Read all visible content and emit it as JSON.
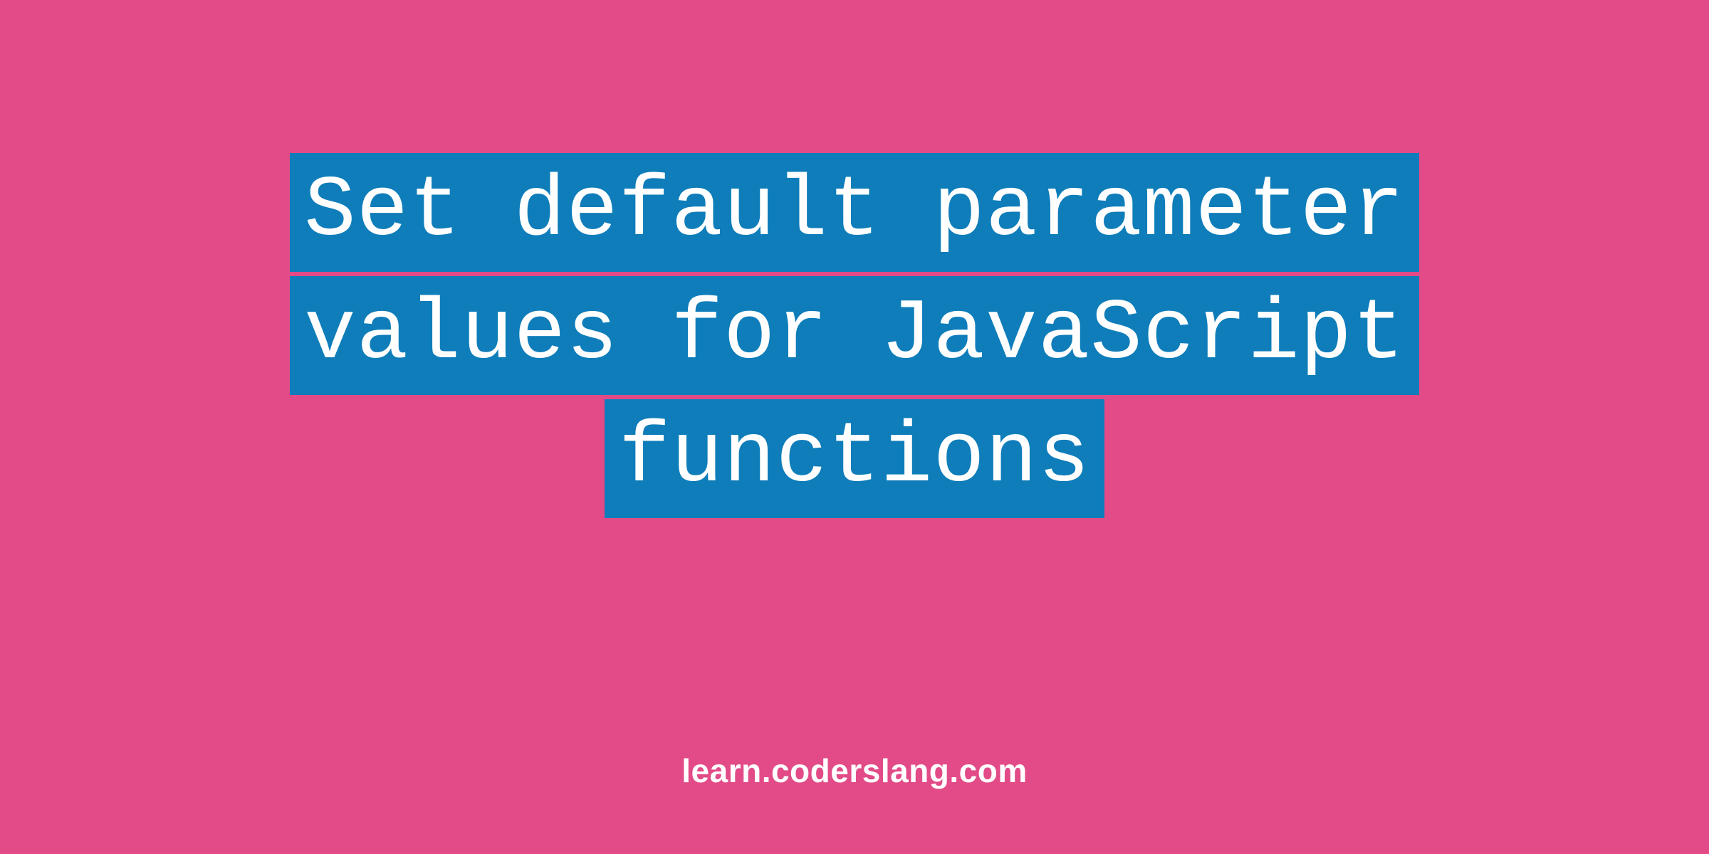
{
  "title": {
    "line1": "Set default parameter",
    "line2": "values for JavaScript",
    "line3": "functions"
  },
  "footer": "learn.coderslang.com",
  "colors": {
    "background": "#e24b87",
    "highlight": "#0e7dba",
    "text": "#ffffff"
  }
}
